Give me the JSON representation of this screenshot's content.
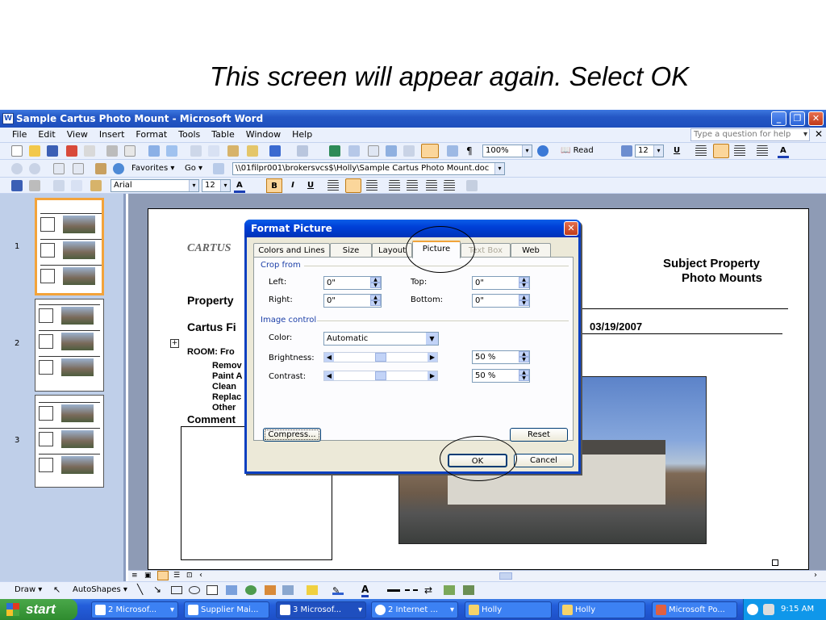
{
  "caption": "This screen will appear again. Select OK",
  "window": {
    "title": "Sample Cartus Photo Mount - Microsoft Word"
  },
  "menu": {
    "items": [
      "File",
      "Edit",
      "View",
      "Insert",
      "Format",
      "Tools",
      "Table",
      "Window",
      "Help"
    ],
    "help_placeholder": "Type a question for help"
  },
  "toolbar": {
    "zoom": "100%",
    "read_label": "Read",
    "font_size_right": "12"
  },
  "web_toolbar": {
    "favorites": "Favorites",
    "go": "Go",
    "address": "\\\\01filpr001\\brokersvcs$\\Holly\\Sample Cartus Photo Mount.doc"
  },
  "format_toolbar": {
    "font": "Arial",
    "size": "12",
    "bold": "B",
    "italic": "I",
    "underline": "U"
  },
  "slides": [
    {
      "number": "1"
    },
    {
      "number": "2"
    },
    {
      "number": "3"
    }
  ],
  "document": {
    "logo": "CARTUS",
    "heading_line1": "Subject Property",
    "heading_line2": "Photo Mounts",
    "property_label": "Property",
    "cartus_file_label": "Cartus Fi",
    "date": "03/19/2007",
    "room_label": "ROOM: Fro",
    "list": [
      "Remov",
      "Paint A",
      "Clean",
      "Replac",
      "Other"
    ],
    "comments_label": "Comment"
  },
  "dialog": {
    "title": "Format Picture",
    "tabs": [
      {
        "label": "Colors and Lines"
      },
      {
        "label": "Size"
      },
      {
        "label": "Layout"
      },
      {
        "label": "Picture"
      },
      {
        "label": "Text Box"
      },
      {
        "label": "Web"
      }
    ],
    "crop_group": "Crop from",
    "left_label": "Left:",
    "left_value": "0\"",
    "right_label": "Right:",
    "right_value": "0\"",
    "top_label": "Top:",
    "top_value": "0\"",
    "bottom_label": "Bottom:",
    "bottom_value": "0\"",
    "image_group": "Image control",
    "color_label": "Color:",
    "color_value": "Automatic",
    "brightness_label": "Brightness:",
    "brightness_value": "50 %",
    "brightness_level": 0.5,
    "contrast_label": "Contrast:",
    "contrast_value": "50 %",
    "contrast_level": 0.5,
    "compress_label": "Compress...",
    "reset_label": "Reset",
    "ok_label": "OK",
    "cancel_label": "Cancel"
  },
  "drawing_toolbar": {
    "draw": "Draw",
    "autoshapes": "AutoShapes"
  },
  "taskbar": {
    "start": "start",
    "tasks": [
      {
        "label": "2 Microsof..."
      },
      {
        "label": "Supplier Mai..."
      },
      {
        "label": "3 Microsof..."
      },
      {
        "label": "2 Internet ..."
      },
      {
        "label": "Holly"
      },
      {
        "label": "Holly"
      },
      {
        "label": "Microsoft Po..."
      }
    ],
    "clock": "9:15 AM"
  }
}
